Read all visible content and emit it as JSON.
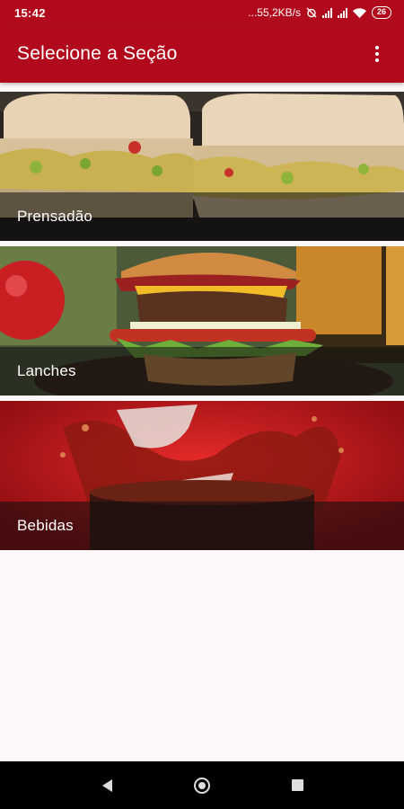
{
  "status_bar": {
    "time": "15:42",
    "network_speed": "...55,2KB/s",
    "battery_level": "26",
    "icons": [
      "alarm-off-icon",
      "signal-icon",
      "signal-icon",
      "wifi-icon",
      "battery-icon"
    ]
  },
  "app_bar": {
    "title": "Selecione a Seção",
    "menu_icon": "more-vert-icon"
  },
  "sections": [
    {
      "label": "Prensadão",
      "image": "pressed-sandwich-photo"
    },
    {
      "label": "Lanches",
      "image": "burger-photo"
    },
    {
      "label": "Bebidas",
      "image": "cola-splash-photo"
    }
  ],
  "nav_bar": {
    "icons": [
      "back-icon",
      "home-icon",
      "recents-icon"
    ]
  },
  "colors": {
    "primary": "#b00a1c",
    "background": "#fdf8f7",
    "nav": "#000000"
  }
}
